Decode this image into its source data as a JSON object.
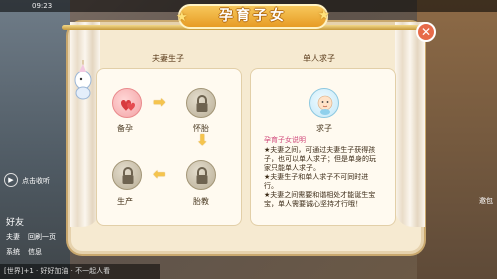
{
  "status": {
    "time": "09:23"
  },
  "background": {
    "chat_lines": [
      "好友",
      "回刷一页",
      "点击收听"
    ],
    "sender_lines": [
      "夫妻",
      "系统",
      "信息"
    ],
    "bottom_chat": "[世界]+1 · 好好加油 · 不一起人看",
    "right_chat": "邀包"
  },
  "modal": {
    "title": "孕育子女",
    "close_icon": "close-icon"
  },
  "couple_panel": {
    "heading": "夫妻生子",
    "nodes": [
      {
        "label": "备孕",
        "icon": "hearts-icon",
        "locked": false
      },
      {
        "label": "怀胎",
        "icon": "lock-icon",
        "locked": true
      },
      {
        "label": "胎教",
        "icon": "lock-icon",
        "locked": true
      },
      {
        "label": "生产",
        "icon": "lock-icon",
        "locked": true
      }
    ]
  },
  "single_panel": {
    "heading": "单人求子",
    "node_label": "求子",
    "node_icon": "baby-icon",
    "desc_title": "孕育子女说明",
    "desc_lines": [
      "★夫妻之间，可通过夫妻生子获得孩",
      "子，也可以单人求子；但是单身的玩",
      "家只能单人求子。",
      "★夫妻生子和单人求子不可同时进",
      "行。",
      "★夫妻之间需要和谐相处才能诞生宝",
      "宝，单人需要诚心坚持才行哦！"
    ]
  },
  "colors": {
    "accent": "#e79c25",
    "desc_title": "#d0487a",
    "close": "#e76b4a"
  }
}
